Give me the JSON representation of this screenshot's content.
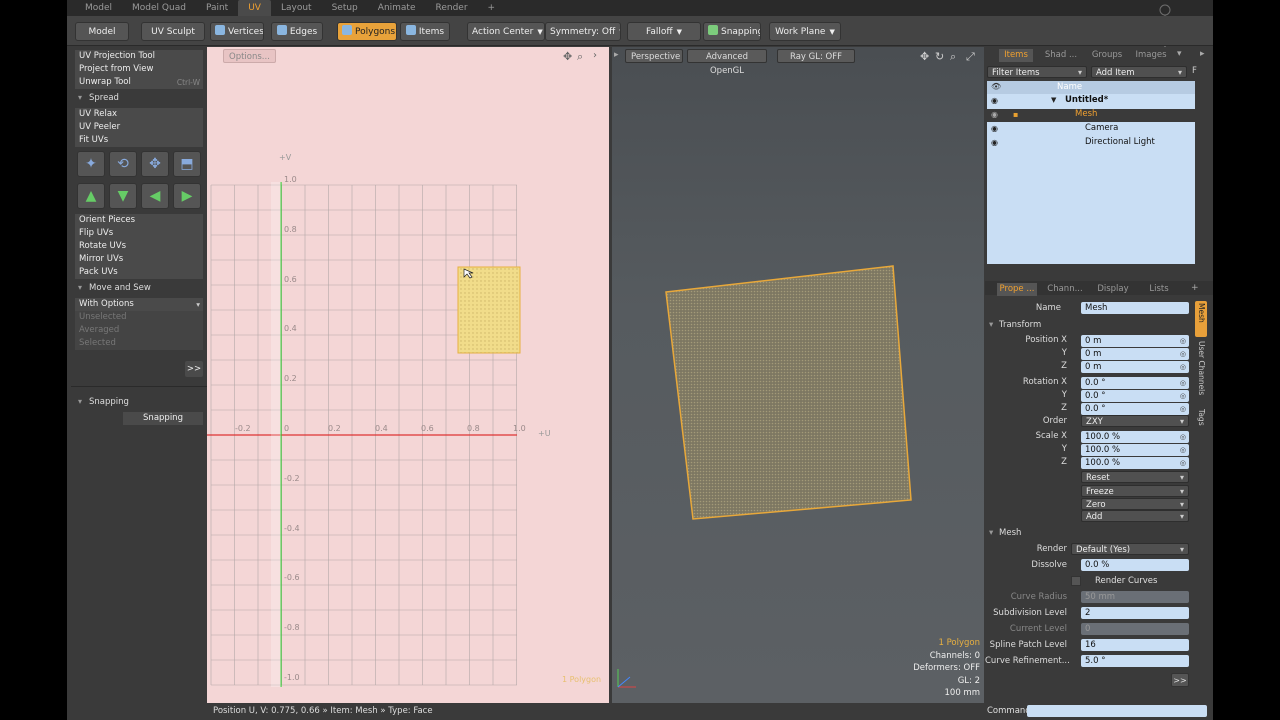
{
  "tabs": [
    "Model",
    "Model Quad",
    "Paint",
    "UV",
    "Layout",
    "Setup",
    "Animate",
    "Render",
    "+"
  ],
  "active_tab": "UV",
  "toolbar": {
    "model": "Model",
    "uv_sculpt": "UV Sculpt",
    "vertices": "Vertices",
    "edges": "Edges",
    "polygons": "Polygons",
    "items": "Items",
    "action_center": "Action Center",
    "symmetry": "Symmetry: Off",
    "falloff": "Falloff",
    "snapping": "Snapping",
    "work_plane": "Work Plane"
  },
  "left_panel": {
    "uv_projection_tool": "UV Projection Tool",
    "project_from_view": "Project from View",
    "unwrap_tool": "Unwrap Tool",
    "unwrap_shortcut": "Ctrl-W",
    "spread_header": "Spread",
    "uv_relax": "UV Relax",
    "uv_peeler": "UV Peeler",
    "fit_uvs": "Fit UVs",
    "orient_pieces": "Orient Pieces",
    "flip_uvs": "Flip UVs",
    "rotate_uvs": "Rotate UVs",
    "mirror_uvs": "Mirror UVs",
    "pack_uvs": "Pack UVs",
    "move_sew_header": "Move and Sew",
    "with_options": "With Options",
    "unselected": "Unselected",
    "averaged": "Averaged",
    "selected": "Selected",
    "more": ">>",
    "snapping_header": "Snapping",
    "snapping_button": "Snapping"
  },
  "uv_view": {
    "options": "Options...",
    "plus_v": "+V",
    "plus_u": "+U",
    "y_ticks": [
      "1.0",
      "0.8",
      "0.6",
      "0.4",
      "0.2",
      "-0.2",
      "-0.4",
      "-0.6",
      "-0.8",
      "-1.0"
    ],
    "x_ticks": [
      "-0.2",
      "0",
      "0.2",
      "0.4",
      "0.6",
      "0.8",
      "1.0"
    ],
    "corner_label": "1 Polygon"
  },
  "persp_view": {
    "perspective": "Perspective",
    "advanced_opengl": "Advanced OpenGL",
    "ray_gl": "Ray GL: OFF",
    "info_polygon": "1 Polygon",
    "info_channels": "Channels: 0",
    "info_deformers": "Deformers: OFF",
    "info_gl": "GL: 2",
    "info_scale": "100 mm"
  },
  "items_panel": {
    "tabs": [
      "Items",
      "Shad ...",
      "Groups",
      "Images"
    ],
    "filter_items": "Filter Items",
    "add_item": "Add Item",
    "col_name": "Name",
    "tree": [
      "Untitled*",
      "Mesh",
      "Camera",
      "Directional Light"
    ]
  },
  "properties": {
    "tabs": [
      "Prope ...",
      "Chann...",
      "Display",
      "Lists"
    ],
    "name_label": "Name",
    "name_value": "Mesh",
    "transform_header": "Transform",
    "position_x_label": "Position X",
    "y_label": "Y",
    "z_label": "Z",
    "position": [
      "0 m",
      "0 m",
      "0 m"
    ],
    "rotation_x_label": "Rotation X",
    "rotation": [
      "0.0 °",
      "0.0 °",
      "0.0 °"
    ],
    "order_label": "Order",
    "order_value": "ZXY",
    "scale_x_label": "Scale X",
    "scale": [
      "100.0 %",
      "100.0 %",
      "100.0 %"
    ],
    "reset": "Reset",
    "freeze": "Freeze",
    "zero": "Zero",
    "add": "Add",
    "mesh_header": "Mesh",
    "render_label": "Render",
    "render_value": "Default (Yes)",
    "dissolve_label": "Dissolve",
    "dissolve_value": "0.0 %",
    "render_curves": "Render Curves",
    "curve_radius_label": "Curve Radius",
    "curve_radius_value": "50 mm",
    "subdivision_label": "Subdivision Level",
    "subdivision_value": "2",
    "current_level_label": "Current Level",
    "current_level_value": "0",
    "spline_patch_label": "Spline Patch Level",
    "spline_patch_value": "16",
    "curve_refinement_label": "Curve Refinement...",
    "curve_refinement_value": "5.0 °",
    "side_tabs": [
      "Mesh",
      "User Channels",
      "Tags"
    ],
    "more": ">>"
  },
  "status_bar": "Position U, V:  0.775, 0.66 » Item: Mesh » Type: Face",
  "command_label": "Command"
}
